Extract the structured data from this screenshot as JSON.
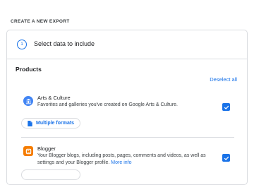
{
  "header": {
    "title": "CREATE A NEW EXPORT"
  },
  "step": {
    "number": "1",
    "title": "Select data to include"
  },
  "products": {
    "title": "Products",
    "deselect_all": "Deselect all",
    "items": [
      {
        "name": "Arts & Culture",
        "description": "Favorites and galleries you've created on Google Arts & Culture.",
        "checked": true,
        "format_button": "Multiple formats",
        "icon": "arts-culture-icon"
      },
      {
        "name": "Blogger",
        "description": "Your Blogger blogs, including posts, pages, comments and videos, as well as settings and your Blogger profile.",
        "more_info": "More info",
        "checked": true,
        "icon": "blogger-icon"
      }
    ]
  },
  "colors": {
    "accent": "#1a73e8",
    "border": "#dadce0",
    "blogger": "#f57c00",
    "arts": "#4285f4"
  }
}
